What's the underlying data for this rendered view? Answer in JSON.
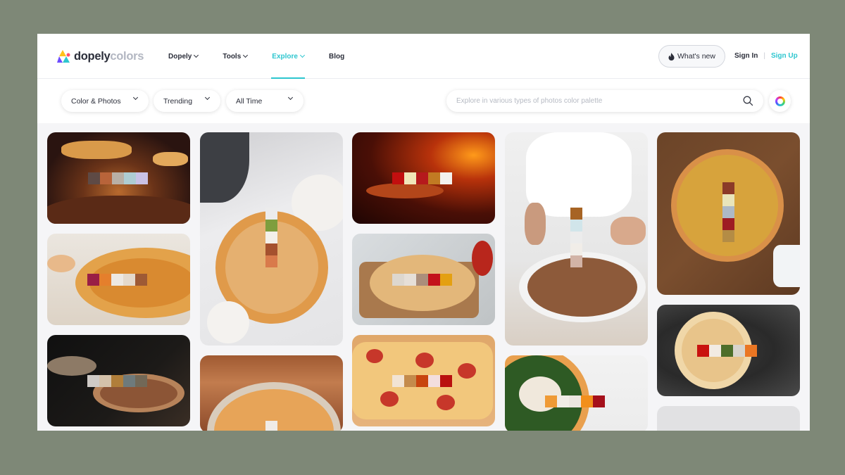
{
  "header": {
    "logo": {
      "primary": "dopely",
      "secondary": "colors"
    },
    "nav": [
      {
        "label": "Dopely",
        "dropdown": true,
        "active": false
      },
      {
        "label": "Tools",
        "dropdown": true,
        "active": false
      },
      {
        "label": "Explore",
        "dropdown": true,
        "active": true
      },
      {
        "label": "Blog",
        "dropdown": false,
        "active": false
      }
    ],
    "whats_new": "What's new",
    "sign_in": "Sign In",
    "separator": "|",
    "sign_up": "Sign Up"
  },
  "filters": {
    "category": "Color & Photos",
    "sort": "Trending",
    "period": "All Time",
    "search_placeholder": "Explore in various types of photos color palette"
  },
  "colors": {
    "accent": "#2ec6cf",
    "text": "#2b2e3a",
    "muted": "#b6bac3"
  },
  "palettes": [
    {
      "id": "c1",
      "subject": "cheese-pull slice",
      "swatches": [
        "#5e4a45",
        "#b8643a",
        "#b9b0a6",
        "#aecdd3",
        "#c9c2e6"
      ]
    },
    {
      "id": "c2",
      "subject": "pizza on table overhead",
      "swatches": [
        "#ececec",
        "#7e9e3e",
        "#f3f0ea",
        "#a5512e",
        "#d97a4b"
      ]
    },
    {
      "id": "c3",
      "subject": "wood-fired oven",
      "swatches": [
        "#c20f0f",
        "#f0e6b8",
        "#b5191c",
        "#c17a23",
        "#f3f1ee"
      ]
    },
    {
      "id": "c4",
      "subject": "chef garnishing pizza",
      "swatches": [
        "#a76424",
        "#d1e5ea",
        "#ececec",
        "#f1ede8",
        "#d2b3a6"
      ]
    },
    {
      "id": "c5",
      "subject": "overhead pizza on wood",
      "swatches": [
        "#8b3a28",
        "#e9e5ba",
        "#adb9c6",
        "#9e1c23",
        "#b48c45"
      ]
    },
    {
      "id": "c6",
      "subject": "pizza slice on paper",
      "swatches": [
        "#991e45",
        "#e57f2c",
        "#ede8e2",
        "#e4d9cc",
        "#9e5a35"
      ]
    },
    {
      "id": "c7",
      "subject": "pizza on board",
      "swatches": [
        "#ddd7cf",
        "#e6dfd8",
        "#ab8e7b",
        "#c3121b",
        "#e4a011"
      ]
    },
    {
      "id": "c8",
      "subject": "dark pizza",
      "swatches": [
        "#cfcac6",
        "#d4c2aa",
        "#b07e3a",
        "#6e7a7c",
        "#726857"
      ]
    },
    {
      "id": "c9",
      "subject": "pepperoni pizza",
      "swatches": [
        "#f2e4d4",
        "#c48b4c",
        "#c8450f",
        "#f3dede",
        "#b9100f"
      ]
    },
    {
      "id": "c10",
      "subject": "basil pizza",
      "swatches": [
        "#ef9a35",
        "#f1ece6",
        "#ece6e0",
        "#f28f1c",
        "#a5101b"
      ]
    },
    {
      "id": "c11",
      "subject": "margherita on slate",
      "swatches": [
        "#c9120f",
        "#f2ebe3",
        "#4d6e2a",
        "#d8d4cc",
        "#ea7623"
      ]
    },
    {
      "id": "c12",
      "subject": "pizza in pan",
      "swatches": [
        "#f0ebe6"
      ]
    },
    {
      "id": "c13",
      "subject": "placeholder",
      "swatches": []
    }
  ]
}
